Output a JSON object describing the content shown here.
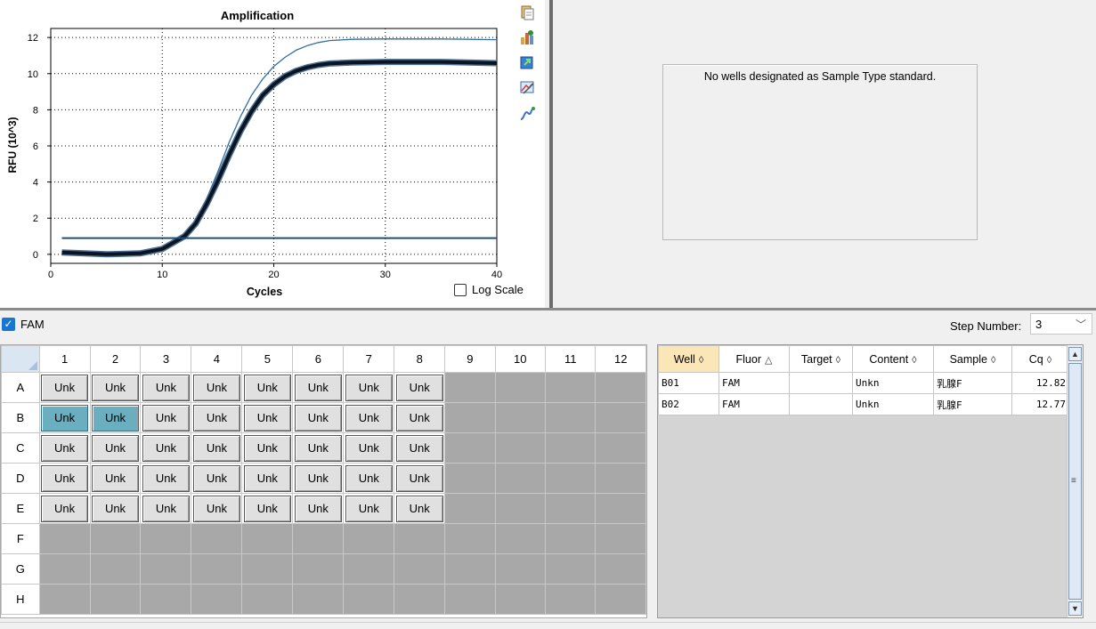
{
  "chart": {
    "title": "Amplification",
    "xlabel": "Cycles",
    "ylabel": "RFU (10^3)",
    "x_ticks": [
      "0",
      "10",
      "20",
      "30",
      "40"
    ],
    "y_ticks": [
      "0",
      "2",
      "4",
      "6",
      "8",
      "10",
      "12"
    ],
    "log_scale_label": "Log Scale",
    "log_scale_checked": false,
    "tool_icons": [
      "copy-icon",
      "chart-options-icon",
      "export-icon",
      "image-export-icon",
      "curve-tool-icon"
    ]
  },
  "chart_data": {
    "type": "line",
    "title": "Amplification",
    "xlabel": "Cycles",
    "ylabel": "RFU (10^3)",
    "xlim": [
      0,
      40
    ],
    "ylim": [
      -0.5,
      12.5
    ],
    "grid": true,
    "series": [
      {
        "name": "B01",
        "color": "#2f6fa3",
        "x": [
          1,
          5,
          8,
          10,
          12,
          13,
          14,
          15,
          16,
          17,
          18,
          19,
          20,
          21,
          22,
          23,
          24,
          25,
          27,
          30,
          35,
          40
        ],
        "y": [
          0.05,
          0.0,
          0.1,
          0.35,
          1.1,
          1.9,
          3.1,
          4.6,
          6.2,
          7.6,
          8.8,
          9.7,
          10.4,
          10.9,
          11.3,
          11.55,
          11.72,
          11.83,
          11.9,
          11.92,
          11.92,
          11.88
        ]
      },
      {
        "name": "B02",
        "color": "#0b1420",
        "x": [
          1,
          5,
          8,
          10,
          12,
          13,
          14,
          15,
          16,
          17,
          18,
          19,
          20,
          21,
          22,
          23,
          24,
          25,
          27,
          30,
          35,
          40
        ],
        "y": [
          0.1,
          0.0,
          0.05,
          0.3,
          1.0,
          1.7,
          2.8,
          4.1,
          5.5,
          6.8,
          7.9,
          8.8,
          9.4,
          9.85,
          10.15,
          10.35,
          10.48,
          10.56,
          10.62,
          10.65,
          10.65,
          10.58
        ]
      },
      {
        "name": "Threshold",
        "color": "#1f4e79",
        "x": [
          1,
          40
        ],
        "y": [
          0.9,
          0.9
        ]
      }
    ]
  },
  "standard_curve": {
    "message": "No wells designated as Sample Type standard."
  },
  "fluor_filter": {
    "label": "FAM",
    "checked": true
  },
  "step": {
    "label": "Step Number:",
    "value": "3"
  },
  "plate": {
    "columns": [
      "1",
      "2",
      "3",
      "4",
      "5",
      "6",
      "7",
      "8",
      "9",
      "10",
      "11",
      "12"
    ],
    "rows": [
      "A",
      "B",
      "C",
      "D",
      "E",
      "F",
      "G",
      "H"
    ],
    "well_label": "Unk",
    "filled_rows": [
      "A",
      "B",
      "C",
      "D",
      "E"
    ],
    "filled_cols": 8,
    "selected_wells": [
      "B1",
      "B2"
    ]
  },
  "results": {
    "headers": [
      {
        "label": "Well",
        "sort": "◊"
      },
      {
        "label": "Fluor",
        "sort": "△"
      },
      {
        "label": "Target",
        "sort": "◊"
      },
      {
        "label": "Content",
        "sort": "◊"
      },
      {
        "label": "Sample",
        "sort": "◊"
      },
      {
        "label": "Cq",
        "sort": "◊"
      }
    ],
    "rows": [
      {
        "well": "B01",
        "fluor": "FAM",
        "target": "",
        "content": "Unkn",
        "sample": "乳腺F",
        "cq": "12.82"
      },
      {
        "well": "B02",
        "fluor": "FAM",
        "target": "",
        "content": "Unkn",
        "sample": "乳腺F",
        "cq": "12.77"
      }
    ],
    "scroll": {
      "up": "▲",
      "down": "▼",
      "grip": "≡"
    }
  }
}
